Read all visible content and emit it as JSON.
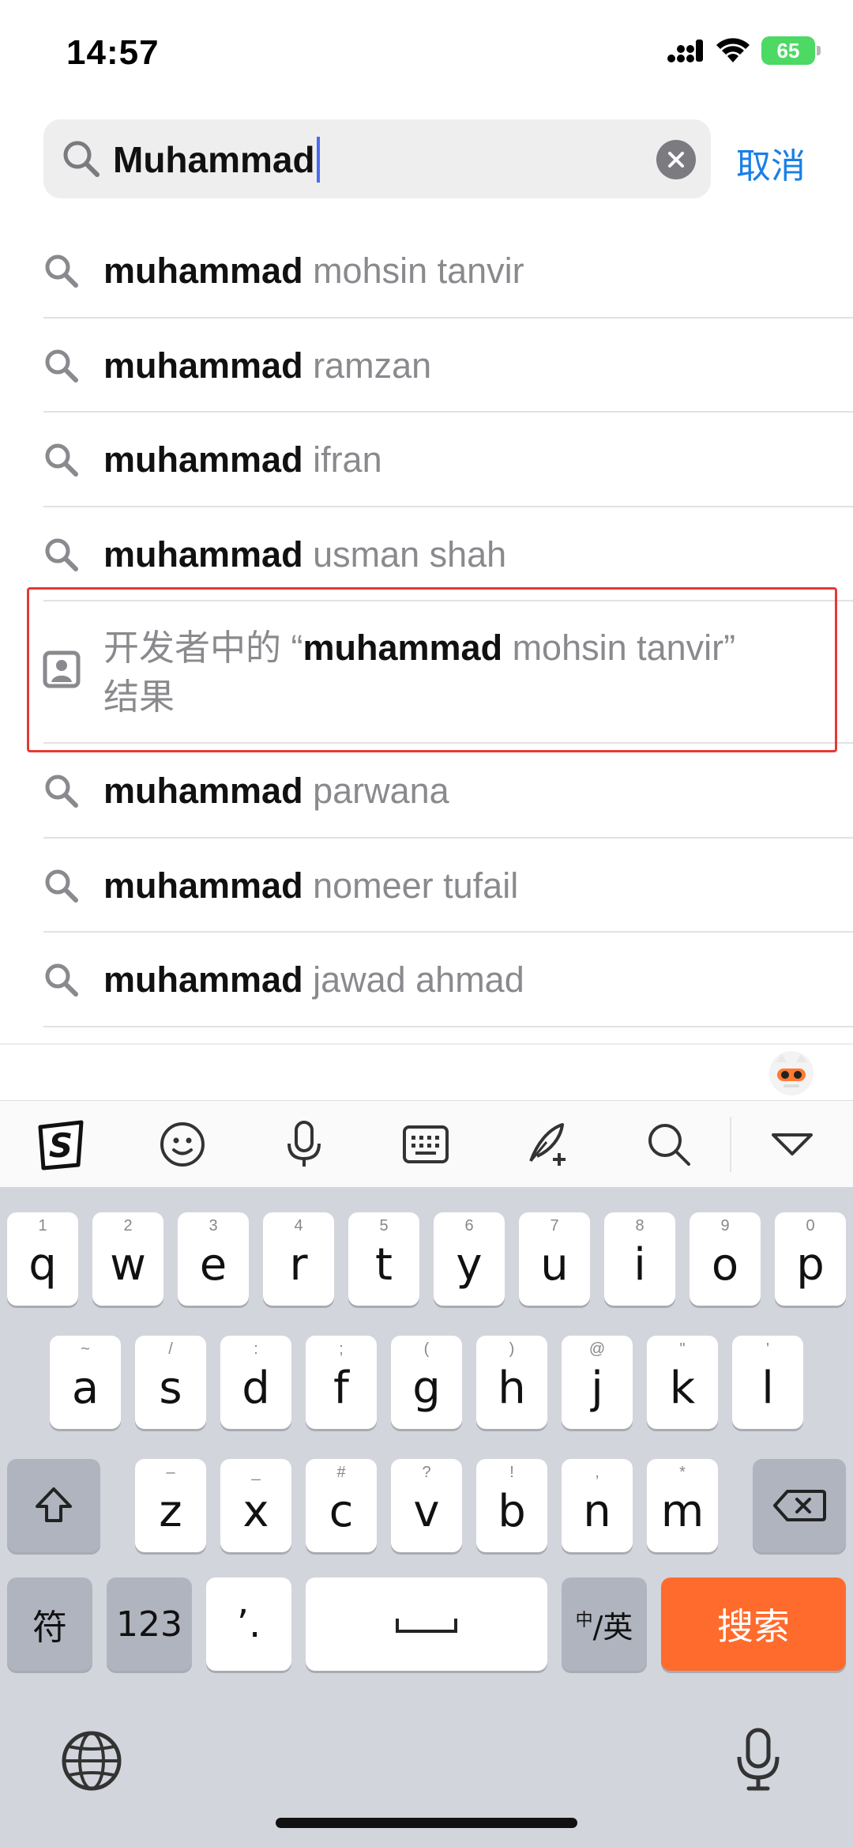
{
  "status_bar": {
    "time": "14:57",
    "battery": "65"
  },
  "search": {
    "query": "Muhammad",
    "cancel_label": "取消"
  },
  "suggestions": [
    {
      "bold": "muhammad",
      "rest": " mohsin tanvir"
    },
    {
      "bold": "muhammad",
      "rest": " ramzan"
    },
    {
      "bold": "muhammad",
      "rest": " ifran"
    },
    {
      "bold": "muhammad",
      "rest": " usman shah"
    }
  ],
  "developer_result": {
    "prefix": "开发者中的 “",
    "bold": "muhammad",
    "rest": " mohsin tanvir”",
    "suffix": "结果"
  },
  "suggestions_more": [
    {
      "bold": "muhammad",
      "rest": " parwana"
    },
    {
      "bold": "muhammad",
      "rest": " nomeer tufail"
    },
    {
      "bold": "muhammad",
      "rest": " jawad ahmad"
    }
  ],
  "toolbar": {
    "icons": [
      "sogou-logo-icon",
      "emoji-icon",
      "microphone-icon",
      "keyboard-icon",
      "handwriting-icon",
      "search-icon",
      "collapse-icon"
    ]
  },
  "keyboard": {
    "row1": [
      {
        "k": "q",
        "s": "1"
      },
      {
        "k": "w",
        "s": "2"
      },
      {
        "k": "e",
        "s": "3"
      },
      {
        "k": "r",
        "s": "4"
      },
      {
        "k": "t",
        "s": "5"
      },
      {
        "k": "y",
        "s": "6"
      },
      {
        "k": "u",
        "s": "7"
      },
      {
        "k": "i",
        "s": "8"
      },
      {
        "k": "o",
        "s": "9"
      },
      {
        "k": "p",
        "s": "0"
      }
    ],
    "row2": [
      {
        "k": "a",
        "s": "~"
      },
      {
        "k": "s",
        "s": "/"
      },
      {
        "k": "d",
        "s": ":"
      },
      {
        "k": "f",
        "s": ";"
      },
      {
        "k": "g",
        "s": "("
      },
      {
        "k": "h",
        "s": ")"
      },
      {
        "k": "j",
        "s": "@"
      },
      {
        "k": "k",
        "s": "\""
      },
      {
        "k": "l",
        "s": "'"
      }
    ],
    "row3": [
      {
        "k": "z",
        "s": "–"
      },
      {
        "k": "x",
        "s": "_"
      },
      {
        "k": "c",
        "s": "#"
      },
      {
        "k": "v",
        "s": "?"
      },
      {
        "k": "b",
        "s": "!"
      },
      {
        "k": "n",
        "s": ","
      },
      {
        "k": "m",
        "s": "*"
      }
    ],
    "symbols_label": "符",
    "numbers_label": "123",
    "punct_label": "’.",
    "space_label": "␣",
    "lang_small": "中",
    "lang_label": "/英",
    "search_key_label": "搜索"
  },
  "colors": {
    "accent_blue": "#1a7fe8",
    "search_key": "#ff6b2c",
    "highlight_border": "#e53935"
  }
}
